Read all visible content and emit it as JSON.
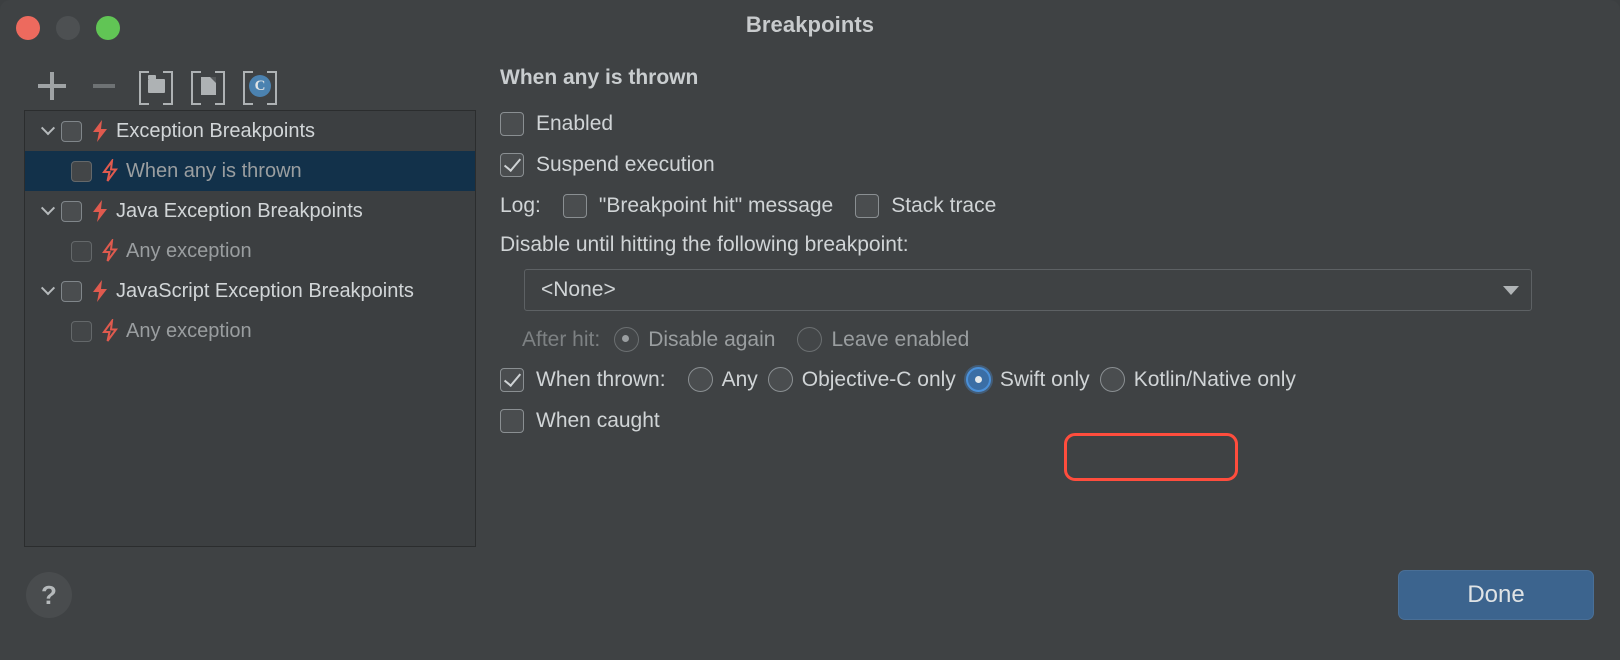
{
  "window": {
    "title": "Breakpoints",
    "traffic_lights": [
      "close",
      "minimize",
      "maximize"
    ]
  },
  "toolbar": {
    "buttons": [
      {
        "name": "add-breakpoint",
        "icon": "plus-icon"
      },
      {
        "name": "remove-breakpoint",
        "icon": "minus-icon"
      },
      {
        "name": "group-by-folder",
        "icon": "folder-bracket-icon"
      },
      {
        "name": "group-by-file",
        "icon": "file-bracket-icon"
      },
      {
        "name": "group-by-class",
        "icon": "class-bracket-icon"
      }
    ]
  },
  "tree": {
    "items": [
      {
        "label": "Exception Breakpoints",
        "level": 0,
        "expanded": true,
        "checked": false,
        "bolt": "solid"
      },
      {
        "label": "When any is thrown",
        "level": 1,
        "expanded": null,
        "checked": false,
        "bolt": "outline",
        "selected": true
      },
      {
        "label": "Java Exception Breakpoints",
        "level": 0,
        "expanded": true,
        "checked": false,
        "bolt": "solid"
      },
      {
        "label": "Any exception",
        "level": 1,
        "expanded": null,
        "checked": false,
        "bolt": "outline"
      },
      {
        "label": "JavaScript Exception Breakpoints",
        "level": 0,
        "expanded": true,
        "checked": false,
        "bolt": "solid"
      },
      {
        "label": "Any exception",
        "level": 1,
        "expanded": null,
        "checked": false,
        "bolt": "outline"
      }
    ]
  },
  "detail": {
    "title": "When any is thrown",
    "enabled": {
      "label": "Enabled",
      "checked": false
    },
    "suspend": {
      "label": "Suspend execution",
      "checked": true
    },
    "log": {
      "label": "Log:",
      "message": {
        "label": "\"Breakpoint hit\" message",
        "checked": false
      },
      "stack_trace": {
        "label": "Stack trace",
        "checked": false
      }
    },
    "disable_until": {
      "label": "Disable until hitting the following breakpoint:",
      "selected_value": "<None>",
      "options": [
        "<None>"
      ]
    },
    "after_hit": {
      "label": "After hit:",
      "options": [
        {
          "label": "Disable again",
          "selected": true
        },
        {
          "label": "Leave enabled",
          "selected": false
        }
      ],
      "disabled": true
    },
    "when_thrown": {
      "label": "When thrown:",
      "checked": true,
      "options": [
        {
          "label": "Any",
          "selected": false
        },
        {
          "label": "Objective-C only",
          "selected": false
        },
        {
          "label": "Swift only",
          "selected": true,
          "highlighted": true
        },
        {
          "label": "Kotlin/Native only",
          "selected": false
        }
      ]
    },
    "when_caught": {
      "label": "When caught",
      "checked": false
    }
  },
  "footer": {
    "help_label": "?",
    "done_label": "Done"
  },
  "colors": {
    "window_bg": "#3f4244",
    "panel_bg": "#3c3f41",
    "selection": "#12314a",
    "accent_blue": "#3c648e",
    "radio_blue": "#4a90d9",
    "highlight_red": "#ff4d3d",
    "bolt_red": "#e05a4e"
  }
}
